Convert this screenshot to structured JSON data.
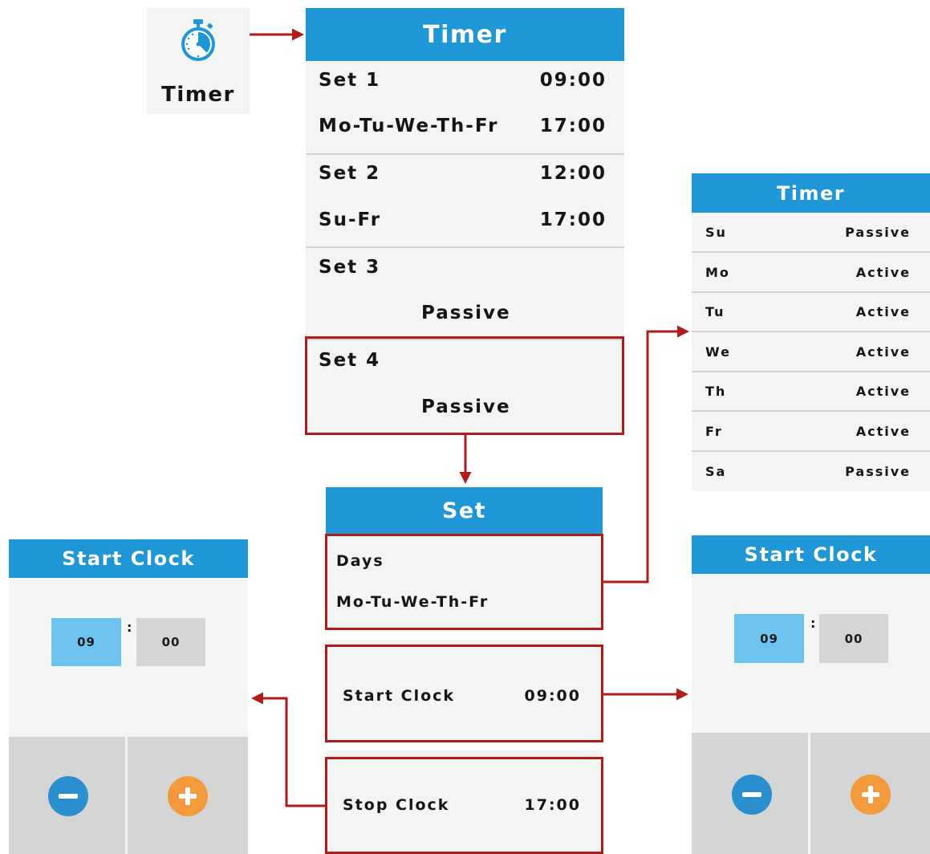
{
  "app_icon": {
    "label": "Timer",
    "icon": "stopwatch-icon",
    "color": "#1f96d6"
  },
  "timer_list": {
    "title": "Timer",
    "sets": [
      {
        "name": "Set 1",
        "days": "Mo-Tu-We-Th-Fr",
        "start": "09:00",
        "stop": "17:00"
      },
      {
        "name": "Set 2",
        "days": "Su-Fr",
        "start": "12:00",
        "stop": "17:00"
      },
      {
        "name": "Set 3",
        "status": "Passive"
      },
      {
        "name": "Set 4",
        "status": "Passive"
      }
    ]
  },
  "days_panel": {
    "title": "Timer",
    "rows": [
      {
        "day": "Su",
        "state": "Passive"
      },
      {
        "day": "Mo",
        "state": "Active"
      },
      {
        "day": "Tu",
        "state": "Active"
      },
      {
        "day": "We",
        "state": "Active"
      },
      {
        "day": "Th",
        "state": "Active"
      },
      {
        "day": "Fr",
        "state": "Active"
      },
      {
        "day": "Sa",
        "state": "Passive"
      }
    ]
  },
  "set_panel": {
    "title": "Set",
    "days_label": "Days",
    "days_value": "Mo-Tu-We-Th-Fr",
    "start_label": "Start Clock",
    "start_value": "09:00",
    "stop_label": "Stop Clock",
    "stop_value": "17:00"
  },
  "clock_left": {
    "title": "Start Clock",
    "hour": "09",
    "separator": ":",
    "minute": "00"
  },
  "clock_right": {
    "title": "Start Clock",
    "hour": "09",
    "separator": ":",
    "minute": "00"
  },
  "buttons": {
    "minus_icon": "minus-circle-icon",
    "plus_icon": "plus-circle-icon"
  },
  "colors": {
    "header_blue": "#1f96d6",
    "highlight_red": "#b21b1b",
    "selected_field": "#6ec4ee",
    "minus_button": "#2a8fce",
    "plus_button": "#f39a3c"
  }
}
